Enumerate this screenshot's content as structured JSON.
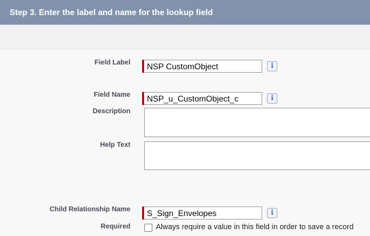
{
  "header": {
    "title": "Step 3. Enter the label and name for the lookup field"
  },
  "fields": {
    "field_label": {
      "label": "Field Label",
      "value": "NSP CustomObject",
      "info_icon": "i"
    },
    "field_name": {
      "label": "Field Name",
      "value": "NSP_u_CustomObject_c",
      "info_icon": "i"
    },
    "description": {
      "label": "Description",
      "value": ""
    },
    "help_text": {
      "label": "Help Text",
      "value": ""
    },
    "child_relationship_name": {
      "label": "Child Relationship Name",
      "value": "S_Sign_Envelopes",
      "info_icon": "i"
    },
    "required": {
      "label": "Required",
      "checkbox_label": "Always require a value in this field in order to save a record",
      "checked": false
    }
  },
  "colors": {
    "header_bg": "#8192aa",
    "required_marker": "#c00000",
    "label_text": "#4a4a56",
    "info_icon": "#3d6fb0"
  },
  "icons": {
    "info": "info-icon",
    "checkbox": "checkbox-unchecked"
  }
}
